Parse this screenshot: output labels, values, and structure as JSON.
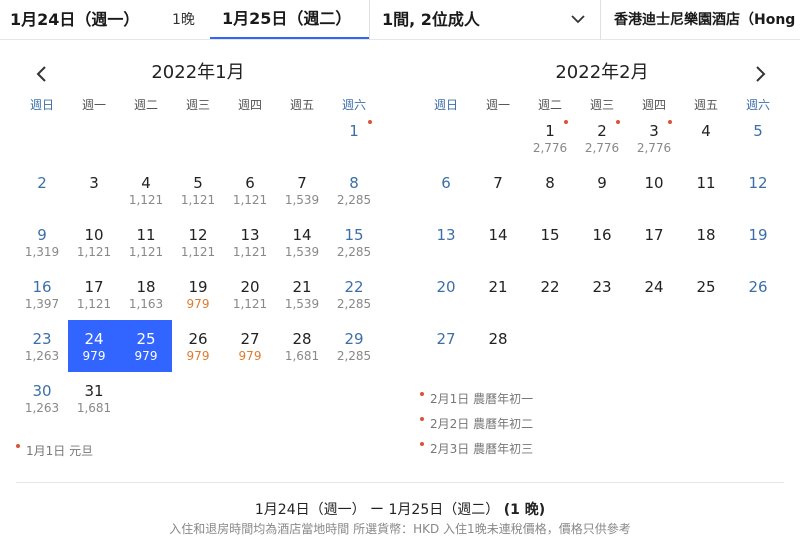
{
  "topbar": {
    "checkin": "1月24日（週一）",
    "nights": "1晚",
    "checkout": "1月25日（週二）",
    "guests": "1間, 2位成人",
    "hotel": "香港迪士尼樂園酒店（Hong"
  },
  "weekdays": [
    "週日",
    "週一",
    "週二",
    "週三",
    "週四",
    "週五",
    "週六"
  ],
  "calendar": {
    "jan": {
      "title": "2022年1月",
      "days": [
        {
          "n": "1",
          "p": "",
          "dot": true
        },
        {
          "n": "2",
          "p": ""
        },
        {
          "n": "3",
          "p": ""
        },
        {
          "n": "4",
          "p": "1,121"
        },
        {
          "n": "5",
          "p": "1,121"
        },
        {
          "n": "6",
          "p": "1,121"
        },
        {
          "n": "7",
          "p": "1,539"
        },
        {
          "n": "8",
          "p": "2,285"
        },
        {
          "n": "9",
          "p": "1,319"
        },
        {
          "n": "10",
          "p": "1,121"
        },
        {
          "n": "11",
          "p": "1,121"
        },
        {
          "n": "12",
          "p": "1,121"
        },
        {
          "n": "13",
          "p": "1,121"
        },
        {
          "n": "14",
          "p": "1,539"
        },
        {
          "n": "15",
          "p": "2,285"
        },
        {
          "n": "16",
          "p": "1,397"
        },
        {
          "n": "17",
          "p": "1,121"
        },
        {
          "n": "18",
          "p": "1,163"
        },
        {
          "n": "19",
          "p": "979",
          "cheap": true
        },
        {
          "n": "20",
          "p": "1,121"
        },
        {
          "n": "21",
          "p": "1,539"
        },
        {
          "n": "22",
          "p": "2,285"
        },
        {
          "n": "23",
          "p": "1,263"
        },
        {
          "n": "24",
          "p": "979",
          "selected": true
        },
        {
          "n": "25",
          "p": "979",
          "selected": true
        },
        {
          "n": "26",
          "p": "979",
          "cheap": true
        },
        {
          "n": "27",
          "p": "979",
          "cheap": true
        },
        {
          "n": "28",
          "p": "1,681"
        },
        {
          "n": "29",
          "p": "2,285"
        },
        {
          "n": "30",
          "p": "1,263"
        },
        {
          "n": "31",
          "p": "1,681"
        }
      ],
      "holidays": [
        "1月1日 元旦"
      ]
    },
    "feb": {
      "title": "2022年2月",
      "days": [
        {
          "n": "1",
          "p": "2,776",
          "dot": true
        },
        {
          "n": "2",
          "p": "2,776",
          "dot": true
        },
        {
          "n": "3",
          "p": "2,776",
          "dot": true
        },
        {
          "n": "4",
          "p": ""
        },
        {
          "n": "5",
          "p": ""
        },
        {
          "n": "6",
          "p": ""
        },
        {
          "n": "7",
          "p": ""
        },
        {
          "n": "8",
          "p": ""
        },
        {
          "n": "9",
          "p": ""
        },
        {
          "n": "10",
          "p": ""
        },
        {
          "n": "11",
          "p": ""
        },
        {
          "n": "12",
          "p": ""
        },
        {
          "n": "13",
          "p": ""
        },
        {
          "n": "14",
          "p": ""
        },
        {
          "n": "15",
          "p": ""
        },
        {
          "n": "16",
          "p": ""
        },
        {
          "n": "17",
          "p": ""
        },
        {
          "n": "18",
          "p": ""
        },
        {
          "n": "19",
          "p": ""
        },
        {
          "n": "20",
          "p": ""
        },
        {
          "n": "21",
          "p": ""
        },
        {
          "n": "22",
          "p": ""
        },
        {
          "n": "23",
          "p": ""
        },
        {
          "n": "24",
          "p": ""
        },
        {
          "n": "25",
          "p": ""
        },
        {
          "n": "26",
          "p": ""
        },
        {
          "n": "27",
          "p": ""
        },
        {
          "n": "28",
          "p": ""
        }
      ],
      "holidays": [
        "2月1日 農曆年初一",
        "2月2日 農曆年初二",
        "2月3日 農曆年初三"
      ]
    }
  },
  "summary": {
    "range": "1月24日（週一） ー 1月25日（週二）",
    "nights": "(1 晚)",
    "note": "入住和退房時間均為酒店當地時間 所選貨幣：HKD 入住1晚未連稅價格，價格只供參考"
  },
  "colors": {
    "accent": "#3264ff",
    "weekend": "#3c6fa8",
    "cheap": "#e07a2e",
    "holiday_dot": "#d9533b"
  }
}
